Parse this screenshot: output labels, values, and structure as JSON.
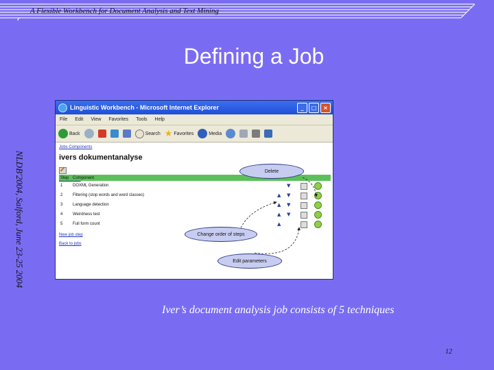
{
  "slide": {
    "header": "A Flexible Workbench for Document Analysis and Text Mining",
    "title": "Defining a Job",
    "side_text": "NLDB'2004, Salford, June 23-25 2004",
    "caption": "Iver’s document analysis job consists of 5 techniques",
    "page_number": "12"
  },
  "browser": {
    "window_title": "Linguistic Workbench - Microsoft Internet Explorer",
    "menu": [
      "File",
      "Edit",
      "View",
      "Favorites",
      "Tools",
      "Help"
    ],
    "toolbar": {
      "back": "Back",
      "search": "Search",
      "favorites": "Favorites",
      "media": "Media"
    },
    "breadcrumb": "Jobs Components",
    "page_heading": "ivers dokumentanalyse",
    "run_link": "Run this job",
    "table": {
      "headers": [
        "Step",
        "Component"
      ],
      "rows": [
        {
          "step": "1",
          "component": "DOXML Generation"
        },
        {
          "step": "2",
          "component": "Filtering (stop words and word classes)"
        },
        {
          "step": "3",
          "component": "Language detection"
        },
        {
          "step": "4",
          "component": "Weirdness test"
        },
        {
          "step": "5",
          "component": "Full form count"
        }
      ]
    },
    "new_step_link": "New job step",
    "back_link": "Back to jobs"
  },
  "annotations": {
    "delete": "Delete",
    "change_order": "Change order of steps",
    "edit_parameters": "Edit parameters"
  },
  "colors": {
    "background": "#7a6cf2",
    "table_header": "#5cc05a",
    "link": "#2233bb"
  }
}
